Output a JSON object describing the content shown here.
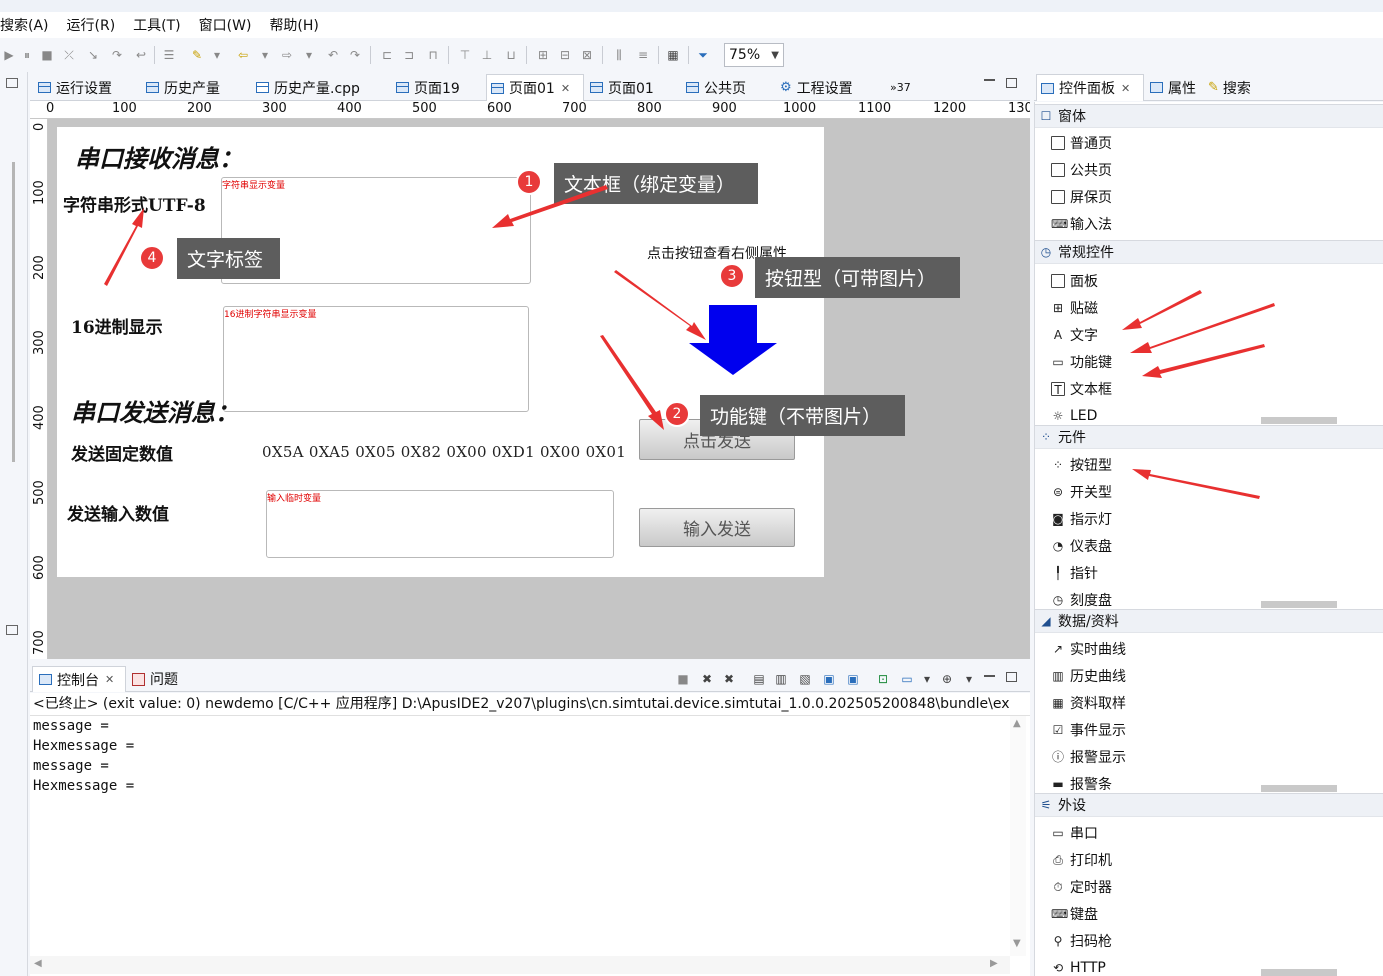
{
  "menu": [
    "搜索(A)",
    "运行(R)",
    "工具(T)",
    "窗口(W)",
    "帮助(H)"
  ],
  "toolbar": {
    "zoom": "75%"
  },
  "editor_tabs": [
    {
      "label": "运行设置"
    },
    {
      "label": "历史产量"
    },
    {
      "label": "历史产量.cpp"
    },
    {
      "label": "页面19"
    },
    {
      "label": "页面01",
      "active": true
    },
    {
      "label": "页面01"
    },
    {
      "label": "公共页"
    },
    {
      "label": "工程设置"
    }
  ],
  "overflow_count": "»37",
  "ruler_h": [
    "0",
    "100",
    "200",
    "300",
    "400",
    "500",
    "600",
    "700",
    "800",
    "900",
    "1000",
    "1100",
    "1200",
    "130"
  ],
  "ruler_v": [
    "0",
    "100",
    "200",
    "300",
    "400",
    "500",
    "600",
    "700"
  ],
  "canvas": {
    "heading_receive": "串口接收消息：",
    "label_utf8": "字符串形式UTF-8",
    "var_string": "字符串显示变量",
    "label_hex": "16进制显示",
    "var_hex": "16进制字符串显示变量",
    "heading_send": "串口发送消息：",
    "label_fixed": "发送固定数值",
    "hex_values": "0X5A 0XA5 0X05 0X82 0X00 0XD1 0X00 0X01",
    "label_input": "发送输入数值",
    "var_input": "输入临时变量",
    "hint": "点击按钮查看右侧属性",
    "btn_click_send": "点击发送",
    "btn_input_send": "输入发送",
    "arrow_color": "#0000ee"
  },
  "callouts": [
    {
      "num": "1",
      "text": "文本框（绑定变量）"
    },
    {
      "num": "2",
      "text": "功能键（不带图片）"
    },
    {
      "num": "3",
      "text": "按钮型（可带图片）"
    },
    {
      "num": "4",
      "text": "文字标签"
    }
  ],
  "console": {
    "tabs": [
      "控制台",
      "问题"
    ],
    "status": "<已终止> (exit value: 0) newdemo [C/C++ 应用程序] D:\\ApusIDE2_v207\\plugins\\cn.simtutai.device.simtutai_1.0.0.202505200848\\bundle\\ex",
    "lines": [
      "message =",
      "Hexmessage =",
      "message =",
      "Hexmessage ="
    ]
  },
  "right_panel": {
    "tabs": [
      "控件面板",
      "属性",
      "搜索"
    ],
    "groups": [
      {
        "title": "窗体",
        "items": [
          "普通页",
          "公共页",
          "屏保页",
          "输入法"
        ]
      },
      {
        "title": "常规控件",
        "items": [
          "面板",
          "贴磁",
          "文字",
          "功能键",
          "文本框",
          "LED"
        ]
      },
      {
        "title": "元件",
        "items": [
          "按钮型",
          "开关型",
          "指示灯",
          "仪表盘",
          "指针",
          "刻度盘"
        ]
      },
      {
        "title": "数据/资料",
        "items": [
          "实时曲线",
          "历史曲线",
          "资料取样",
          "事件显示",
          "报警显示",
          "报警条"
        ]
      },
      {
        "title": "外设",
        "items": [
          "串口",
          "打印机",
          "定时器",
          "键盘",
          "扫码枪",
          "HTTP"
        ]
      }
    ]
  },
  "colors": {
    "accent_red": "#e83a3a",
    "callout_bg": "#5d5d5d"
  }
}
